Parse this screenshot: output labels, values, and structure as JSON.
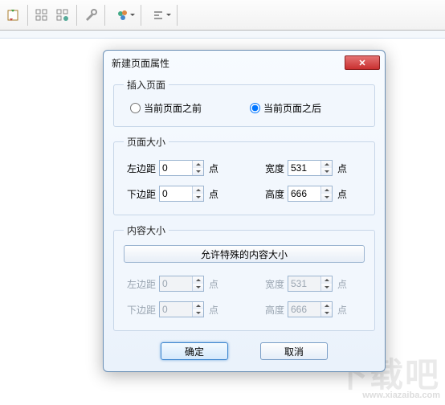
{
  "toolbar": {
    "icons": [
      "refresh-icon",
      "grid-icon",
      "grid-plus-icon",
      "tools-icon",
      "palette-icon",
      "align-icon"
    ]
  },
  "dialog": {
    "title": "新建页面属性",
    "close_glyph": "✕",
    "insert": {
      "legend": "插入页面",
      "before_label": "当前页面之前",
      "after_label": "当前页面之后",
      "selected": "after"
    },
    "page_size": {
      "legend": "页面大小",
      "left_label": "左边距",
      "left_value": "0",
      "bottom_label": "下边距",
      "bottom_value": "0",
      "width_label": "宽度",
      "width_value": "531",
      "height_label": "高度",
      "height_value": "666",
      "unit": "点"
    },
    "content_size": {
      "legend": "内容大小",
      "special_button": "允许特殊的内容大小",
      "left_label": "左边距",
      "left_value": "0",
      "bottom_label": "下边距",
      "bottom_value": "0",
      "width_label": "宽度",
      "width_value": "531",
      "height_label": "高度",
      "height_value": "666",
      "unit": "点"
    },
    "ok_label": "确定",
    "cancel_label": "取消"
  },
  "watermark": {
    "text": "下载吧",
    "url": "www.xiazaiba.com"
  }
}
